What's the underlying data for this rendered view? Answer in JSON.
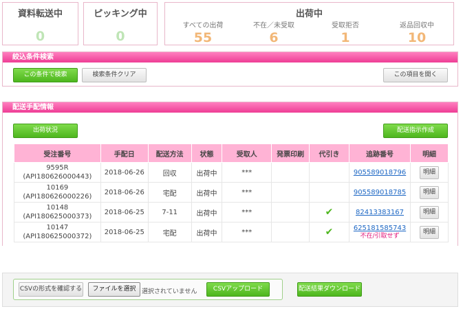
{
  "stats": {
    "transferring": {
      "title": "資料転送中",
      "value": "0"
    },
    "picking": {
      "title": "ピッキング中",
      "value": "0"
    },
    "shipping": {
      "title": "出荷中",
      "items": [
        {
          "label": "すべての出荷",
          "value": "55"
        },
        {
          "label": "不在／未受取",
          "value": "6"
        },
        {
          "label": "受取拒否",
          "value": "1"
        },
        {
          "label": "返品回収中",
          "value": "10"
        }
      ]
    }
  },
  "filter": {
    "header": "絞込条件検索",
    "search_label": "この条件で検索",
    "clear_label": "検索条件クリア",
    "open_label": "この項目を開く"
  },
  "delivery": {
    "header": "配送手配情報",
    "status_button": "出荷状況",
    "create_button": "配送指示作成",
    "columns": [
      "受注番号",
      "手配日",
      "配送方法",
      "状態",
      "受取人",
      "発票印刷",
      "代引き",
      "追跡番号",
      "明細"
    ],
    "rows": [
      {
        "order": "9595R",
        "order_sub": "(API180626000443)",
        "date": "2018-06-26",
        "method": "回収",
        "status": "出荷中",
        "recipient": "***",
        "invoice": "",
        "cod": false,
        "tracking": "905589018796",
        "tracking_note": "",
        "detail": "明細"
      },
      {
        "order": "10169",
        "order_sub": "(API180626000226)",
        "date": "2018-06-26",
        "method": "宅配",
        "status": "出荷中",
        "recipient": "***",
        "invoice": "",
        "cod": false,
        "tracking": "905589018785",
        "tracking_note": "",
        "detail": "明細"
      },
      {
        "order": "10148",
        "order_sub": "(API180625000373)",
        "date": "2018-06-25",
        "method": "7-11",
        "status": "出荷中",
        "recipient": "***",
        "invoice": "",
        "cod": true,
        "tracking": "82413383167",
        "tracking_note": "",
        "detail": "明細"
      },
      {
        "order": "10147",
        "order_sub": "(API180625000372)",
        "date": "2018-06-25",
        "method": "宅配",
        "status": "出荷中",
        "recipient": "***",
        "invoice": "",
        "cod": true,
        "tracking": "625181585743",
        "tracking_note": "不在/引取せず",
        "detail": "明細"
      }
    ]
  },
  "upload": {
    "check_label": "CSVの形式を確認する",
    "choose_label": "ファイルを選択",
    "file_status": "選択されていません",
    "upload_label": "CSVアップロード",
    "download_label": "配送結果ダウンロード"
  },
  "colors": {
    "accent_pink": "#ee3d95",
    "table_header": "#ffb3d5",
    "green_button": "#4eb61e",
    "zero_value": "#bfe5b6",
    "count_value": "#f2b777",
    "link": "#1d67c4",
    "warning": "#e0147a"
  },
  "icons": {
    "cod_check": "check-icon"
  }
}
